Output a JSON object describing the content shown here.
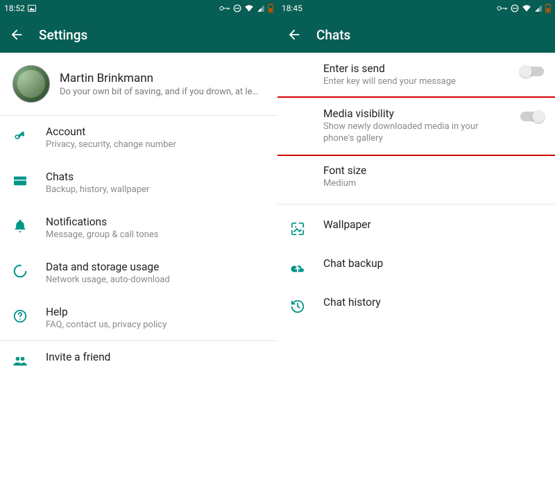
{
  "left": {
    "statusbar": {
      "time": "18:52"
    },
    "appbar": {
      "title": "Settings"
    },
    "profile": {
      "name": "Martin Brinkmann",
      "status": "Do your own bit of saving, and if you drown, at le…"
    },
    "items": [
      {
        "title": "Account",
        "sub": "Privacy, security, change number"
      },
      {
        "title": "Chats",
        "sub": "Backup, history, wallpaper"
      },
      {
        "title": "Notifications",
        "sub": "Message, group & call tones"
      },
      {
        "title": "Data and storage usage",
        "sub": "Network usage, auto-download"
      },
      {
        "title": "Help",
        "sub": "FAQ, contact us, privacy policy"
      },
      {
        "title": "Invite a friend"
      }
    ]
  },
  "right": {
    "statusbar": {
      "time": "18:45"
    },
    "appbar": {
      "title": "Chats"
    },
    "items": [
      {
        "title": "Enter is send",
        "sub": "Enter key will send your message"
      },
      {
        "title": "Media visibility",
        "sub": "Show newly downloaded media in your phone's gallery"
      },
      {
        "title": "Font size",
        "sub": "Medium"
      }
    ],
    "actions": [
      {
        "title": "Wallpaper"
      },
      {
        "title": "Chat backup"
      },
      {
        "title": "Chat history"
      }
    ]
  }
}
